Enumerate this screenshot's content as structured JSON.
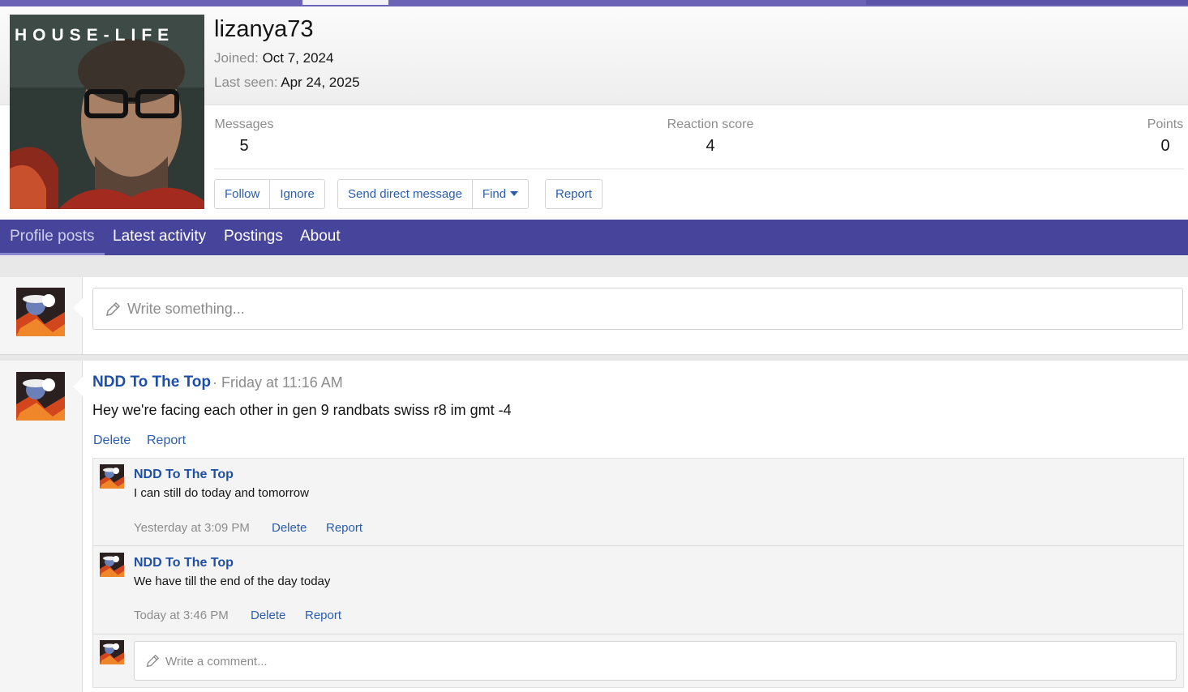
{
  "profile": {
    "avatar_text": "HOUSE-LIFE",
    "username": "lizanya73",
    "joined_label": "Joined:",
    "joined_value": "Oct 7, 2024",
    "last_seen_label": "Last seen:",
    "last_seen_value": "Apr 24, 2025"
  },
  "stats": {
    "messages_label": "Messages",
    "messages_value": "5",
    "reaction_label": "Reaction score",
    "reaction_value": "4",
    "points_label": "Points",
    "points_value": "0"
  },
  "actions": {
    "follow": "Follow",
    "ignore": "Ignore",
    "send_dm": "Send direct message",
    "find": "Find",
    "report": "Report"
  },
  "tabs": [
    {
      "label": "Profile posts"
    },
    {
      "label": "Latest activity"
    },
    {
      "label": "Postings"
    },
    {
      "label": "About"
    }
  ],
  "composer": {
    "placeholder": "Write something..."
  },
  "post": {
    "user": "NDD To The Top",
    "time": "· Friday at 11:16 AM",
    "body": "Hey we're facing each other in gen 9 randbats swiss r8 im gmt -4",
    "delete": "Delete",
    "report": "Report"
  },
  "comments": [
    {
      "user": "NDD To The Top",
      "body": "I can still do today and tomorrow",
      "time": "Yesterday at 3:09 PM",
      "delete": "Delete",
      "report": "Report"
    },
    {
      "user": "NDD To The Top",
      "body": "We have till the end of the day today",
      "time": "Today at 3:46 PM",
      "delete": "Delete",
      "report": "Report"
    }
  ],
  "comment_box": {
    "placeholder": "Write a comment..."
  },
  "colors": {
    "accent": "#47449b",
    "link": "#2a5db0",
    "username": "#1e4fa8",
    "muted": "#8c8c8c"
  }
}
